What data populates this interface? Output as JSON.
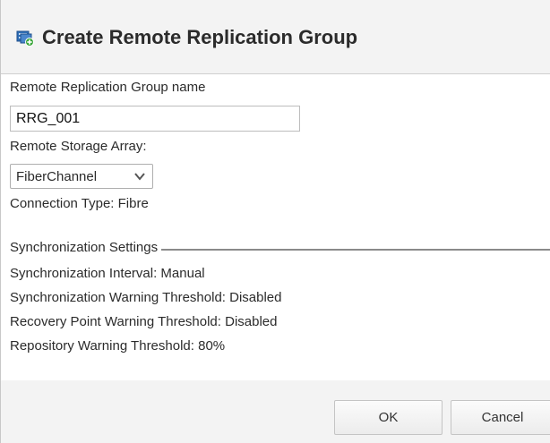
{
  "dialog": {
    "title": "Create Remote Replication Group",
    "icon": "replication-group-add-icon"
  },
  "form": {
    "group_name_label": "Remote Replication Group name",
    "group_name_value": "RRG_001",
    "remote_array_label": "Remote Storage Array:",
    "remote_array_selected": "FiberChannel",
    "connection_type": "Connection Type: Fibre"
  },
  "sync": {
    "section_label": "Synchronization Settings",
    "interval": "Synchronization Interval: Manual",
    "warning_threshold": "Synchronization Warning Threshold: Disabled",
    "recovery_point_threshold": "Recovery Point Warning Threshold: Disabled",
    "repository_threshold": "Repository Warning Threshold: 80%"
  },
  "buttons": {
    "ok": "OK",
    "cancel": "Cancel"
  },
  "colors": {
    "icon_blue": "#2f6fb7",
    "icon_green": "#3aa63a"
  }
}
